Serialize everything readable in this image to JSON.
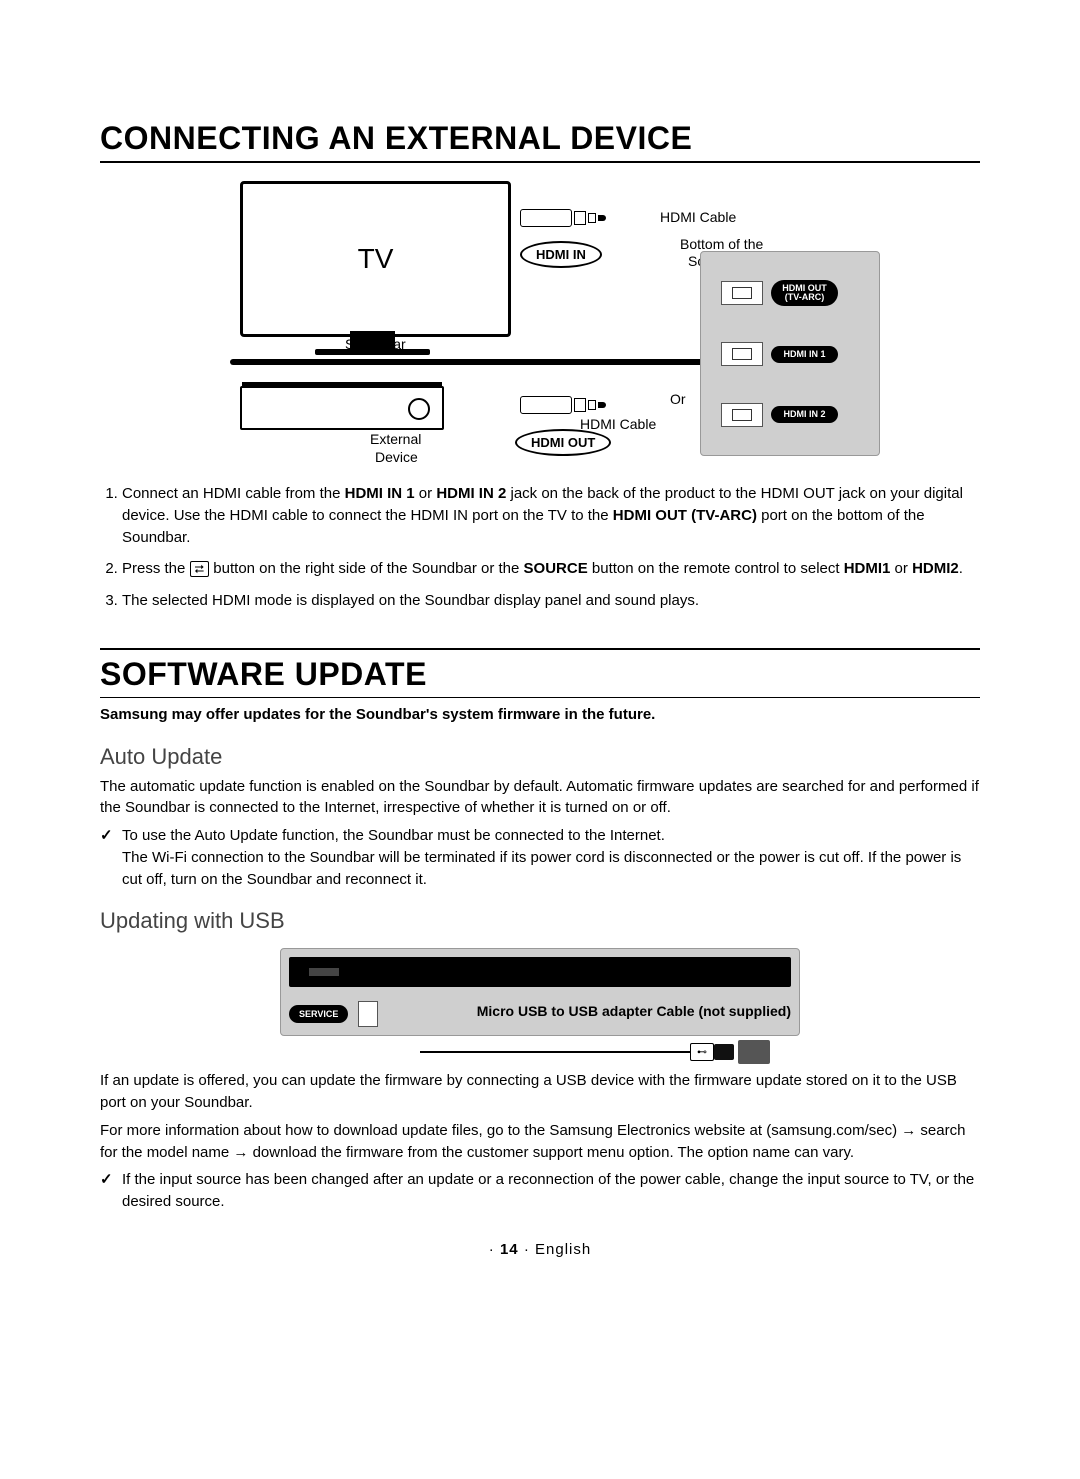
{
  "section1": {
    "title": "CONNECTING AN EXTERNAL DEVICE",
    "diagram": {
      "tv_label": "TV",
      "hdmi_in_oval": "HDMI IN",
      "hdmi_out_oval": "HDMI OUT",
      "hdmi_cable_top": "HDMI Cable",
      "hdmi_cable_bottom": "HDMI Cable",
      "bottom_of_soundbar_line1": "Bottom of the",
      "bottom_of_soundbar_line2": "Soundbar",
      "soundbar_label": "Soundbar",
      "external_device_line1": "External",
      "external_device_line2": "Device",
      "or_label": "Or",
      "ports": {
        "hdmi_out_tvarc_line1": "HDMI OUT",
        "hdmi_out_tvarc_line2": "(TV-ARC)",
        "hdmi_in1": "HDMI IN 1",
        "hdmi_in2": "HDMI IN 2"
      }
    },
    "steps": {
      "s1_a": "Connect an HDMI cable from the ",
      "s1_b_bold": "HDMI IN 1",
      "s1_c": " or ",
      "s1_d_bold": "HDMI IN 2",
      "s1_e": " jack on the back of the product to the HDMI OUT jack on your digital device. Use the HDMI cable to connect the HDMI IN port on the TV to the ",
      "s1_f_bold": "HDMI OUT (TV-ARC)",
      "s1_g": " port on the bottom of the Soundbar.",
      "s2_a": "Press the ",
      "s2_b": " button on the right side of the Soundbar or the ",
      "s2_c_bold": "SOURCE",
      "s2_d": " button on the remote control to select ",
      "s2_e_bold": "HDMI1",
      "s2_f": " or ",
      "s2_g_bold": "HDMI2",
      "s2_h": ".",
      "s3": "The selected HDMI mode is displayed on the Soundbar display panel and sound plays."
    }
  },
  "section2": {
    "title": "SOFTWARE UPDATE",
    "intro_bold": "Samsung may offer updates for the Soundbar's system firmware in the future.",
    "auto_update": {
      "heading": "Auto Update",
      "p1": "The automatic update function is enabled on the Soundbar by default. Automatic firmware updates are searched for and performed if the Soundbar is connected to the Internet, irrespective of whether it is turned on or off.",
      "bullet1": "To use the Auto Update function, the Soundbar must be connected to the Internet.\nThe Wi-Fi connection to the Soundbar will be terminated if its power cord is disconnected or the power is cut off. If the power is cut off, turn on the Soundbar and reconnect it."
    },
    "updating_usb": {
      "heading": "Updating with USB",
      "diagram_caption_bold": "Micro USB to USB adapter Cable (not supplied)",
      "service_label": "SERVICE",
      "p1": "If an update is offered, you can update the firmware by connecting a USB device with the firmware update stored on it to the USB port on your Soundbar.",
      "p2_a": "For more information about how to download update files, go to the Samsung Electronics website at (samsung.com/sec) ",
      "p2_b": " search for the model name ",
      "p2_c": " download the firmware from the customer support menu option. The option name can vary.",
      "bullet1": "If the input source has been changed after an update or a reconnection of the power cable, change the input source to TV, or the desired source."
    }
  },
  "footer": {
    "page_num": "14",
    "lang": "English",
    "dot": "·"
  }
}
